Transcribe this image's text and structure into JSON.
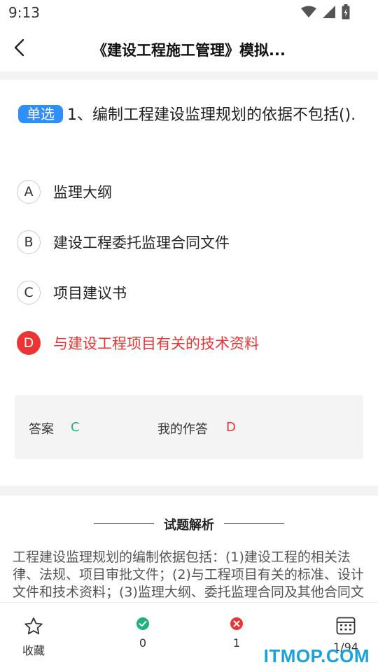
{
  "status": {
    "time": "9:13"
  },
  "header": {
    "title": "《建设工程施工管理》模拟..."
  },
  "question": {
    "tag": "单选",
    "text": "1、编制工程建设监理规划的依据不包括().",
    "options": [
      {
        "letter": "A",
        "text": "监理大纲"
      },
      {
        "letter": "B",
        "text": "建设工程委托监理合同文件"
      },
      {
        "letter": "C",
        "text": "项目建议书"
      },
      {
        "letter": "D",
        "text": "与建设工程项目有关的技术资料"
      }
    ]
  },
  "answer": {
    "label": "答案",
    "value": "C",
    "my_label": "我的作答",
    "my_value": "D",
    "correct_color": "#20b27a",
    "wrong_color": "#ec3434"
  },
  "analysis": {
    "title": "试题解析",
    "text": "工程建设监理规划的编制依据包括：(1)建设工程的相关法律、法规、项目审批文件；(2)与工程项目有关的标准、设计文件和技术资料；(3)监理大纲、委托监理合同及其他合同文件，故选C项不属于工程建设监理规划的编制依据。"
  },
  "bottom": {
    "favorite_label": "收藏",
    "correct_count": "0",
    "wrong_count": "1",
    "progress": "1/94"
  },
  "watermark": "ITMOP.COM"
}
